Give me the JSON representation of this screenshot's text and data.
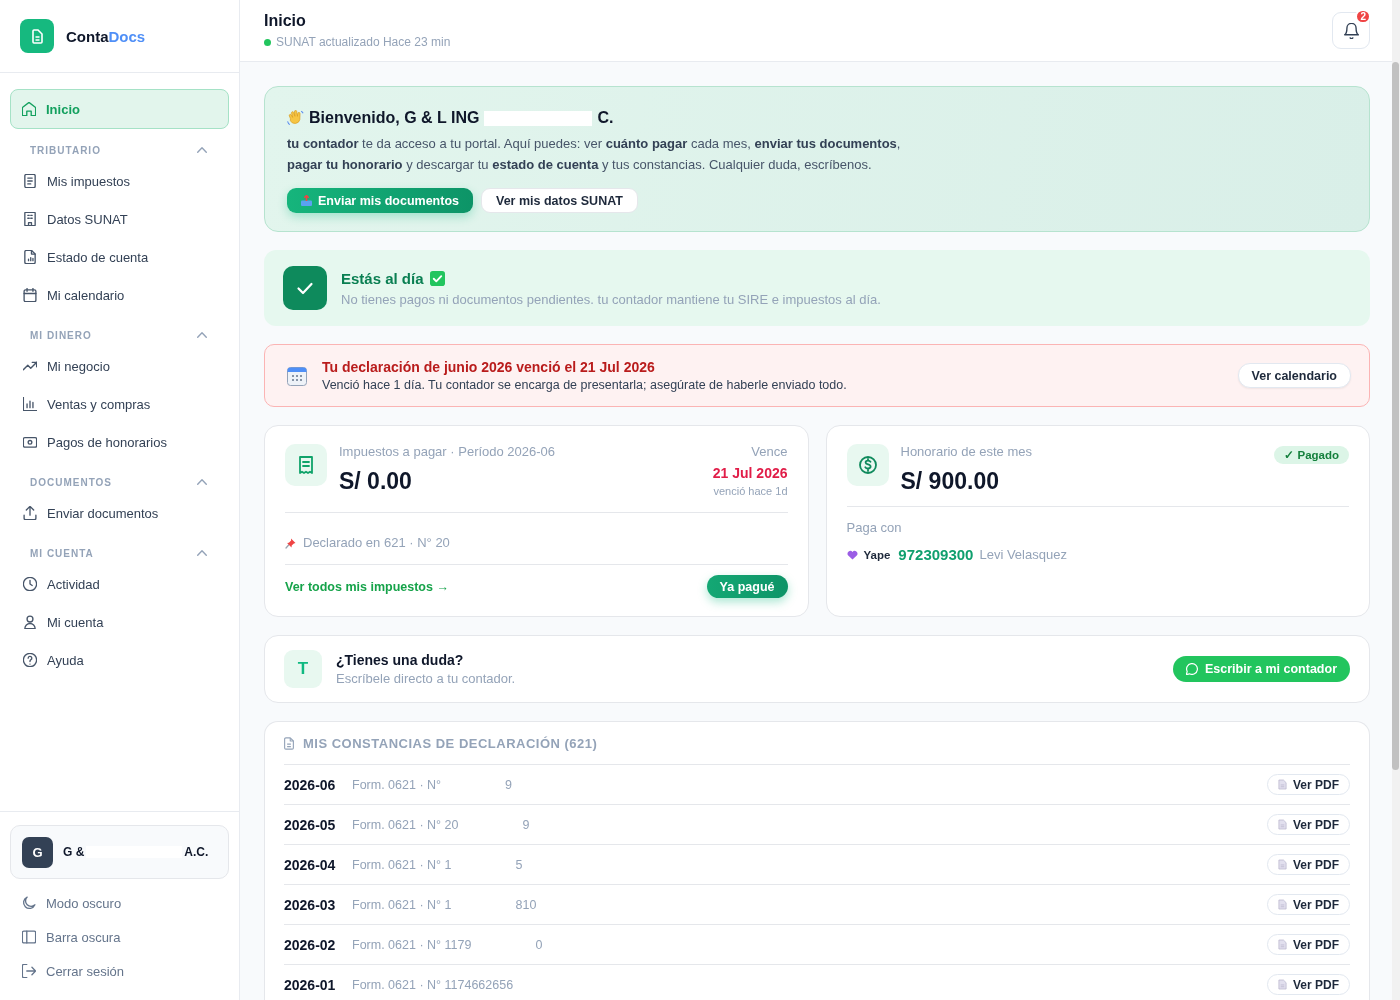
{
  "sidebar": {
    "brand": {
      "name": "Conta",
      "accent": "Docs"
    },
    "items": [
      {
        "label": "Inicio",
        "selected": true
      }
    ],
    "sections": [
      {
        "title": "TRIBUTARIO",
        "expanded": true,
        "items": [
          {
            "label": "Mis impuestos",
            "selected": false
          },
          {
            "label": "Datos SUNAT",
            "selected": false
          },
          {
            "label": "Estado de cuenta",
            "selected": false
          },
          {
            "label": "Mi calendario",
            "selected": false
          }
        ]
      },
      {
        "title": "MI DINERO",
        "expanded": true,
        "items": [
          {
            "label": "Mi negocio",
            "selected": false
          },
          {
            "label": "Ventas y compras",
            "selected": false
          },
          {
            "label": "Pagos de honorarios",
            "selected": false
          }
        ]
      },
      {
        "title": "DOCUMENTOS",
        "expanded": true,
        "items": [
          {
            "label": "Enviar documentos",
            "selected": false
          }
        ]
      },
      {
        "title": "MI CUENTA",
        "expanded": true,
        "items": [
          {
            "label": "Actividad",
            "selected": false
          },
          {
            "label": "Mi cuenta",
            "selected": false
          },
          {
            "label": "Ayuda",
            "selected": false
          }
        ]
      }
    ],
    "company": {
      "initial": "G",
      "name_start": "G &",
      "name_end": "A.C."
    },
    "footer_items": [
      {
        "label": "Modo oscuro"
      },
      {
        "label": "Barra oscura"
      },
      {
        "label": "Cerrar sesión"
      }
    ]
  },
  "header": {
    "title": "Inicio",
    "status": "SUNAT actualizado Hace 23 min",
    "notifications": "2"
  },
  "welcome": {
    "title_start": "Bienvenido, G & L ING",
    "title_end": "C.",
    "text": "**tu contador** te da acceso a tu portal. Aquí puedes: ver **cuánto pagar** cada mes, **enviar tus documentos**, **pagar tu honorario** y descargar tu **estado de cuenta** y tus constancias. Cualquier duda, escríbenos.",
    "buttons": [
      {
        "label": "Enviar mis documentos",
        "kind": "primary"
      },
      {
        "label": "Ver mis datos SUNAT",
        "kind": "secondary"
      }
    ]
  },
  "status": {
    "title": "Estás al día",
    "text": "No tienes pagos ni documentos pendientes. tu contador mantiene tu SIRE e impuestos al día."
  },
  "alert": {
    "title": "Tu declaración de junio 2026 venció el 21 Jul 2026",
    "text": "Venció hace 1 día. Tu contador se encarga de presentarla; asegúrate de haberle enviado todo.",
    "button": "Ver calendario"
  },
  "tax_card": {
    "label": "Impuestos a pagar · Período 2026-06",
    "amount": "S/ 0.00",
    "due_label": "Vence",
    "due_date": "21 Jul 2026",
    "due_note": "venció hace 1d",
    "declared": "Declarado en 621 · N° 20",
    "link": "Ver todos mis impuestos →",
    "button": "Ya pagué"
  },
  "fee_card": {
    "label": "Honorario de este mes",
    "amount": "S/ 900.00",
    "badge": "✓ Pagado",
    "pay_with": "Paga con",
    "method": "Yape",
    "phone": "972309300",
    "holder": "Levi Velasquez"
  },
  "help": {
    "initial": "T",
    "title": "¿Tienes una duda?",
    "text": "Escríbele directo a tu contador.",
    "button": "Escribir a mi contador"
  },
  "declarations": {
    "title": "MIS CONSTANCIAS DE DECLARACIÓN (621)",
    "rows": [
      {
        "period": "2026-06",
        "number": "Form. 0621 · N°",
        "number_end": "9",
        "button": "Ver PDF"
      },
      {
        "period": "2026-05",
        "number": "Form. 0621 · N° 20",
        "number_end": "9",
        "button": "Ver PDF"
      },
      {
        "period": "2026-04",
        "number": "Form. 0621 · N° 1",
        "number_end": "5",
        "button": "Ver PDF"
      },
      {
        "period": "2026-03",
        "number": "Form. 0621 · N° 1",
        "number_end": "810",
        "button": "Ver PDF"
      },
      {
        "period": "2026-02",
        "number": "Form. 0621 · N° 1179",
        "number_end": "0",
        "button": "Ver PDF"
      },
      {
        "period": "2026-01",
        "number": "Form. 0621 · N° 1174662656",
        "button": "Ver PDF"
      }
    ]
  }
}
